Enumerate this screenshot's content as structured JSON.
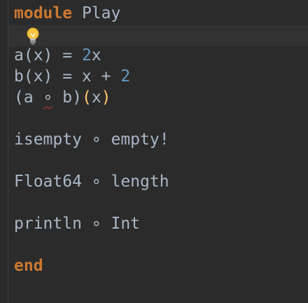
{
  "editor": {
    "lines": [
      {
        "tokens": [
          {
            "text": "module",
            "cls": "kw"
          },
          {
            "text": " Play",
            "cls": ""
          }
        ]
      },
      {
        "tokens": []
      },
      {
        "tokens": [
          {
            "text": "a(x) = ",
            "cls": ""
          },
          {
            "text": "2",
            "cls": "num"
          },
          {
            "text": "x",
            "cls": ""
          }
        ]
      },
      {
        "tokens": [
          {
            "text": "b(x) = x + ",
            "cls": ""
          },
          {
            "text": "2",
            "cls": "num"
          }
        ]
      },
      {
        "tokens": [
          {
            "text": "(a ",
            "cls": ""
          },
          {
            "text": "∘",
            "cls": "squiggle"
          },
          {
            "text": " b)",
            "cls": ""
          },
          {
            "text": "(",
            "cls": "paren"
          },
          {
            "text": "x",
            "cls": ""
          },
          {
            "text": ")",
            "cls": "paren"
          }
        ]
      },
      {
        "tokens": []
      },
      {
        "tokens": [
          {
            "text": "isempty ∘ empty!",
            "cls": ""
          }
        ]
      },
      {
        "tokens": []
      },
      {
        "tokens": [
          {
            "text": "Float64 ∘ length",
            "cls": ""
          }
        ]
      },
      {
        "tokens": []
      },
      {
        "tokens": [
          {
            "text": "println ∘ Int",
            "cls": ""
          }
        ]
      },
      {
        "tokens": []
      },
      {
        "tokens": [
          {
            "text": "end",
            "cls": "kw"
          }
        ]
      }
    ]
  },
  "intention_icon": "lightbulb-icon"
}
